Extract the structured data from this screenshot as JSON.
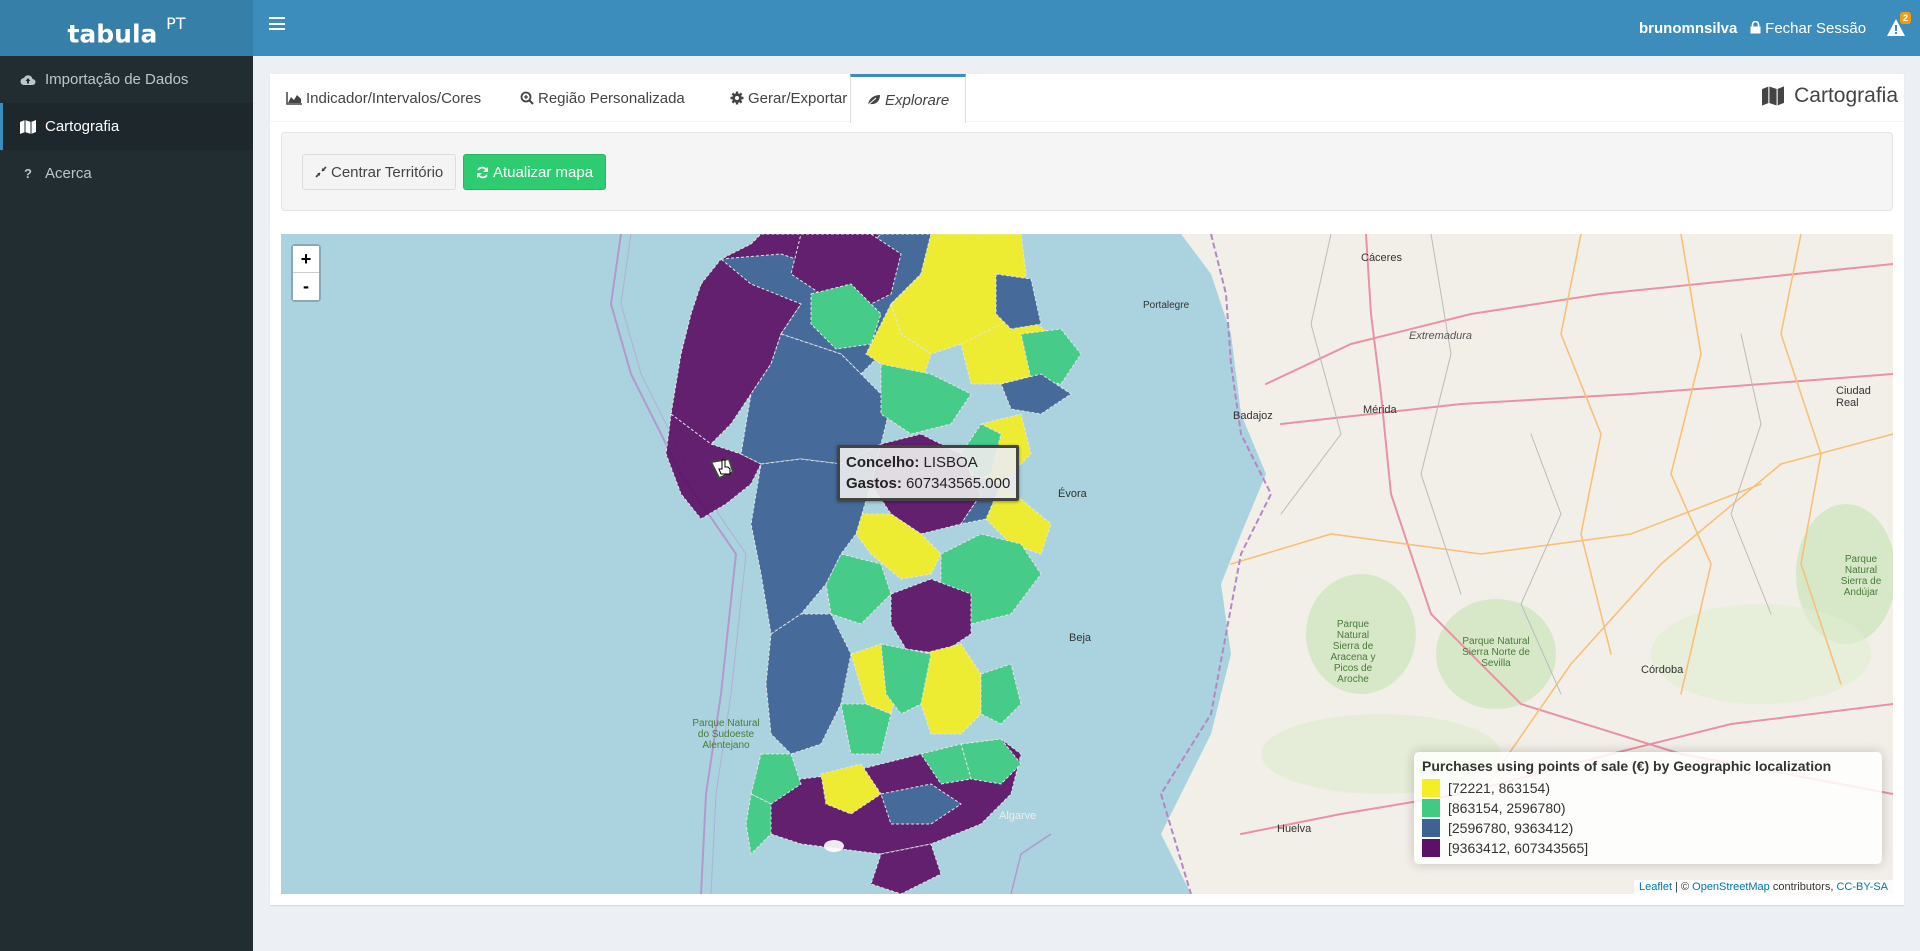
{
  "app": {
    "logo": "tabula",
    "logo_sup": "PT"
  },
  "header": {
    "user": "brunomnsilva",
    "logout": "Fechar Sessão",
    "alert_count": "2"
  },
  "sidebar": {
    "items": [
      {
        "label": "Importação de Dados",
        "icon": "cloud-upload-icon"
      },
      {
        "label": "Cartografia",
        "icon": "map-icon",
        "active": true
      },
      {
        "label": "Acerca",
        "icon": "question-icon"
      }
    ]
  },
  "tabs": [
    {
      "label": "Indicador/Intervalos/Cores",
      "icon": "area-chart-icon"
    },
    {
      "label": "Região Personalizada",
      "icon": "search-plus-icon"
    },
    {
      "label": "Gerar/Exportar",
      "icon": "gear-icon"
    },
    {
      "label": "Explorare",
      "icon": "leaf-icon",
      "active": true
    }
  ],
  "box_title": "Cartografia",
  "buttons": {
    "center": "Centrar Território",
    "update": "Atualizar mapa"
  },
  "map": {
    "zoom_in": "+",
    "zoom_out": "-",
    "tooltip": {
      "label1": "Concelho:",
      "value1": "LISBOA",
      "label2": "Gastos:",
      "value2": "607343565.000"
    },
    "legend": {
      "title": "Purchases using points of sale (€) by Geographic localization",
      "items": [
        {
          "label": "[72221, 863154)",
          "color": "#f4ef24"
        },
        {
          "label": "[863154, 2596780)",
          "color": "#3fcb82"
        },
        {
          "label": "[2596780, 9363412)",
          "color": "#3e6294"
        },
        {
          "label": "[9363412, 607343565]",
          "color": "#5c1166"
        }
      ]
    },
    "attribution": {
      "leaflet": "Leaflet",
      "sep": " | © ",
      "osm": "OpenStreetMap",
      "contrib": " contributors, ",
      "license": "CC-BY-SA"
    },
    "places": {
      "extremadura": "Extremadura",
      "caceres": "Cáceres",
      "merida": "Mérida",
      "badajoz": "Badajoz",
      "portalegre": "Portalegre",
      "evora": "Évora",
      "beja": "Beja",
      "algarve": "Algarve",
      "huelva": "Huelva",
      "cordoba": "Córdoba",
      "ciudad_real": "Ciudad Real",
      "aracena": "Parque Natural Sierra de Aracena y Picos de Aroche",
      "sevilla": "Parque Natural Sierra Norte de Sevilla",
      "andujar": "Parque Natural Sierra de Andújar",
      "sudoeste": "Parque Natural do Sudoeste Alentejano"
    }
  }
}
